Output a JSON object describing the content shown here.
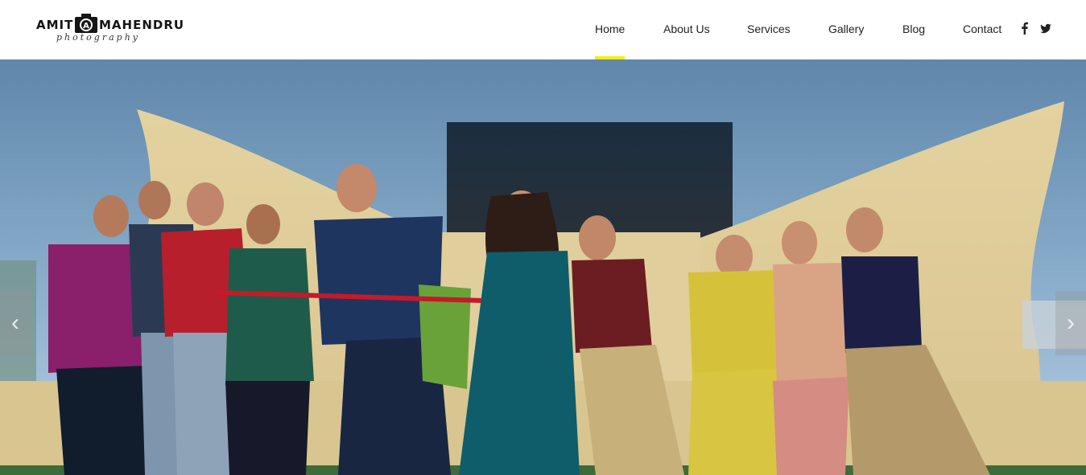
{
  "logo": {
    "left_word": "AMIT",
    "right_word": "MAHENDRU",
    "script": "photography",
    "monogram": "A"
  },
  "nav": {
    "items": [
      {
        "label": "Home",
        "active": true
      },
      {
        "label": "About Us",
        "active": false
      },
      {
        "label": "Services",
        "active": false
      },
      {
        "label": "Gallery",
        "active": false
      },
      {
        "label": "Blog",
        "active": false
      },
      {
        "label": "Contact",
        "active": false
      }
    ],
    "social": [
      "facebook-icon",
      "twitter-icon"
    ]
  },
  "hero": {
    "slider": {
      "prev_icon": "chevron-left-icon",
      "next_icon": "chevron-right-icon"
    }
  },
  "colors": {
    "accent": "#f3ec12",
    "nav_text": "#222222",
    "sky": "#6c94b8",
    "wall": "#e7d7a6"
  }
}
